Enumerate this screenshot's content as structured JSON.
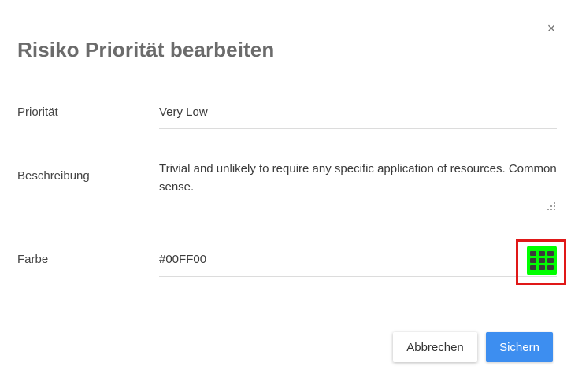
{
  "dialog": {
    "title": "Risiko Priorität bearbeiten",
    "close_icon": "close-icon",
    "close_glyph": "×"
  },
  "fields": {
    "priority": {
      "label": "Priorität",
      "value": "Very Low"
    },
    "description": {
      "label": "Beschreibung",
      "value": "Trivial and unlikely to require any specific application of resources. Common sense."
    },
    "color": {
      "label": "Farbe",
      "value": "#00FF00",
      "swatch_color": "#00FF00",
      "picker_icon": "grid-icon"
    }
  },
  "buttons": {
    "cancel_label": "Abbrechen",
    "save_label": "Sichern"
  },
  "colors": {
    "primary": "#3d8ef0",
    "highlight_border": "#e01818",
    "title_text": "#6b6b6b"
  }
}
